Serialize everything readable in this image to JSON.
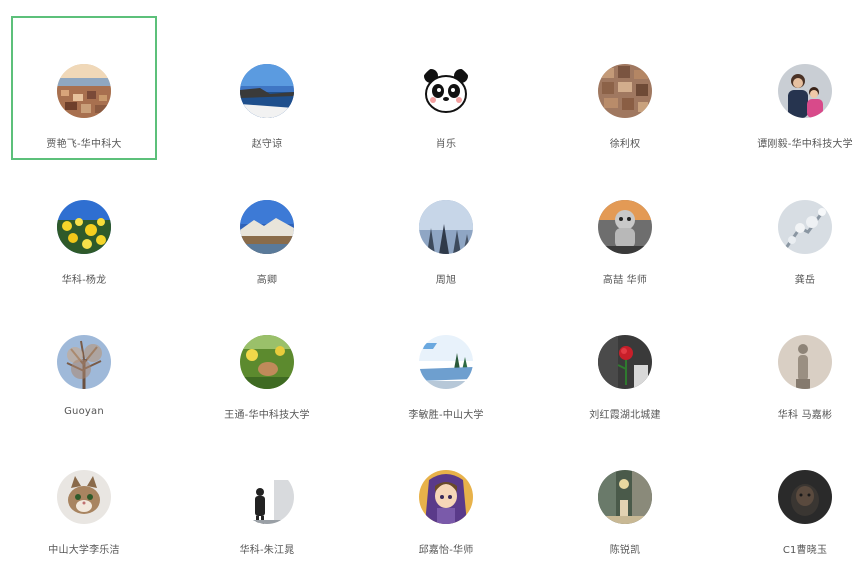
{
  "contacts": [
    {
      "name": "贾艳飞-华中科大",
      "icon": "coastal-town-avatar",
      "selected": true
    },
    {
      "name": "赵守谅",
      "icon": "seaside-landscape-avatar"
    },
    {
      "name": "肖乐",
      "icon": "panda-cartoon-avatar"
    },
    {
      "name": "徐利权",
      "icon": "rock-wall-avatar"
    },
    {
      "name": "谭刚毅-华中科技大学",
      "icon": "family-photo-avatar"
    },
    {
      "name": "华科-杨龙",
      "icon": "yellow-flowers-avatar"
    },
    {
      "name": "高卿",
      "icon": "mountain-lake-avatar"
    },
    {
      "name": "周旭",
      "icon": "misty-forest-avatar"
    },
    {
      "name": "高喆 华师",
      "icon": "stuffed-toy-avatar"
    },
    {
      "name": "龚岳",
      "icon": "frosted-branch-avatar"
    },
    {
      "name": "Guoyan",
      "icon": "bare-tree-avatar"
    },
    {
      "name": "王通-华中科技大学",
      "icon": "green-garden-avatar"
    },
    {
      "name": "李敏胜-中山大学",
      "icon": "lake-trees-avatar"
    },
    {
      "name": "刘红霞湖北城建",
      "icon": "red-rose-avatar"
    },
    {
      "name": "华科 马嘉彬",
      "icon": "statue-avatar"
    },
    {
      "name": "中山大学李乐洁",
      "icon": "cat-avatar"
    },
    {
      "name": "华科-朱江晁",
      "icon": "figure-silhouette-avatar"
    },
    {
      "name": "邱嘉怡-华师",
      "icon": "anime-girl-avatar"
    },
    {
      "name": "陈锐凯",
      "icon": "night-street-avatar"
    },
    {
      "name": "C1曹晓玉",
      "icon": "dark-portrait-avatar"
    }
  ]
}
